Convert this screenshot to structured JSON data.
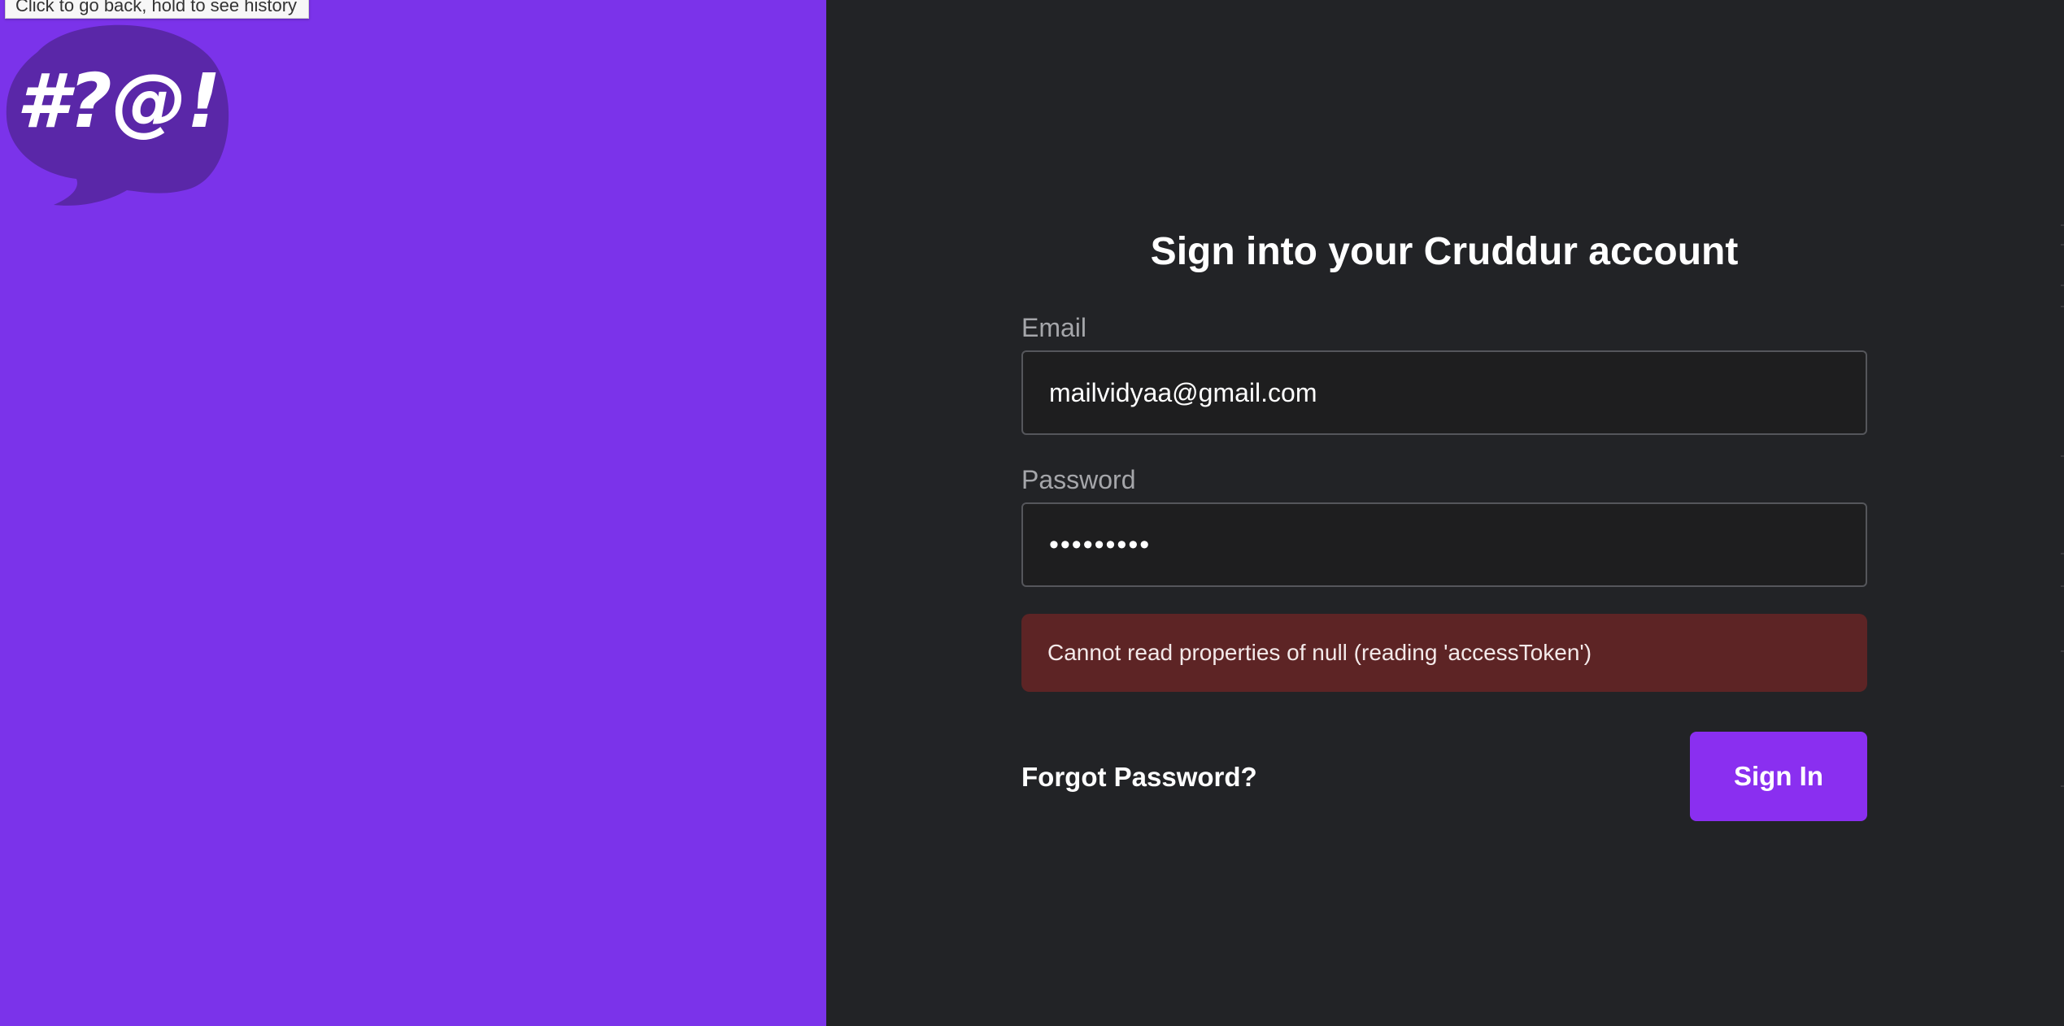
{
  "tooltip": {
    "text": "Click to go back, hold to see history"
  },
  "logo": {
    "text": "#?@!",
    "bubble_color": "#5a27a8"
  },
  "colors": {
    "left_panel": "#7b33ea",
    "right_panel": "#222326",
    "accent": "#8a2ff0",
    "error_bg": "#5d2425"
  },
  "form": {
    "title": "Sign into your Cruddur account",
    "email": {
      "label": "Email",
      "value": "mailvidyaa@gmail.com"
    },
    "password": {
      "label": "Password",
      "value": "•••••••••"
    },
    "error": "Cannot read properties of null (reading 'accessToken')",
    "forgot_password": "Forgot Password?",
    "submit_label": "Sign In"
  }
}
